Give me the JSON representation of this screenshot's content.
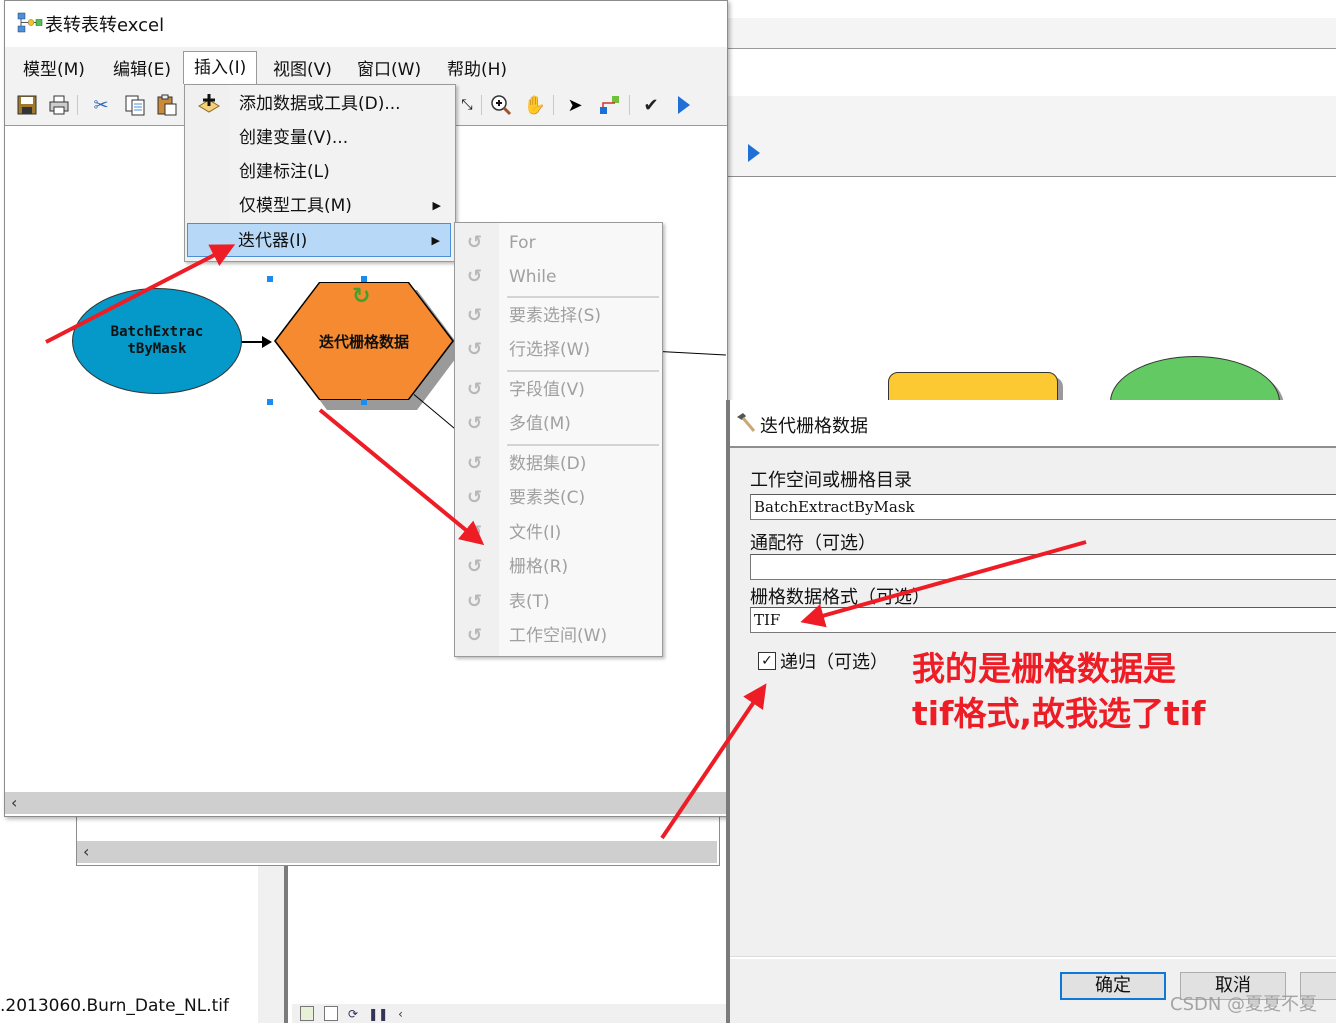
{
  "window": {
    "title": "表转表转excel",
    "menu": [
      {
        "label": "模型(M)"
      },
      {
        "label": "编辑(E)"
      },
      {
        "label": "插入(I)",
        "open": true
      },
      {
        "label": "视图(V)"
      },
      {
        "label": "窗口(W)"
      },
      {
        "label": "帮助(H)"
      }
    ],
    "toolbar_icons": [
      "save-icon",
      "print-icon",
      "cut-icon",
      "copy-icon",
      "paste-icon",
      "full-extent-icon",
      "zoom-in-icon",
      "pan-hand-icon",
      "select-pointer-icon",
      "connect-icon",
      "validate-check-icon",
      "run-icon"
    ],
    "scroll_left_glyph": "‹"
  },
  "insert_menu": {
    "items": [
      {
        "label": "添加数据或工具(D)...",
        "icon": "add-data-icon"
      },
      {
        "label": "创建变量(V)..."
      },
      {
        "label": "创建标注(L)"
      },
      {
        "label": "仅模型工具(M)",
        "submenu": true
      },
      {
        "label": "迭代器(I)",
        "submenu": true,
        "highlighted": true
      }
    ],
    "submenu_arrow": "▶"
  },
  "iterator_menu": {
    "items": [
      {
        "label": "For"
      },
      {
        "label": "While"
      },
      {
        "label": "要素选择(S)"
      },
      {
        "label": "行选择(W)"
      },
      {
        "label": "字段值(V)"
      },
      {
        "label": "多值(M)"
      },
      {
        "label": "数据集(D)"
      },
      {
        "label": "要素类(C)"
      },
      {
        "label": "文件(I)"
      },
      {
        "label": "栅格(R)"
      },
      {
        "label": "表(T)"
      },
      {
        "label": "工作空间(W)"
      }
    ],
    "icon_glyph": "↺"
  },
  "model": {
    "input_node": {
      "line1": "BatchExtrac",
      "line2": "tByMask",
      "color": "#0599c9"
    },
    "iterator_node": {
      "label": "迭代栅格数据",
      "color": "#f58a30"
    },
    "loop_glyph": "↻"
  },
  "dialog": {
    "title": "迭代栅格数据",
    "fields": [
      {
        "label": "工作空间或栅格目录",
        "value": "BatchExtractByMask"
      },
      {
        "label": "通配符（可选）",
        "value": ""
      },
      {
        "label": "栅格数据格式（可选）",
        "value": "TIF"
      }
    ],
    "recursive": {
      "label": "递归（可选）",
      "checked": true,
      "check_glyph": "✓"
    },
    "buttons": {
      "ok": "确定",
      "cancel": "取消"
    }
  },
  "annotation": {
    "line1": "我的是栅格数据是",
    "line2": "tif格式,故我选了tif",
    "color": "#ee1c25"
  },
  "background": {
    "file_label": ".2013060.Burn_Date_NL.tif",
    "chevron_down": "⌄",
    "lower_scroll_glyph": "‹",
    "watermark": "CSDN @夏夏不夏"
  }
}
